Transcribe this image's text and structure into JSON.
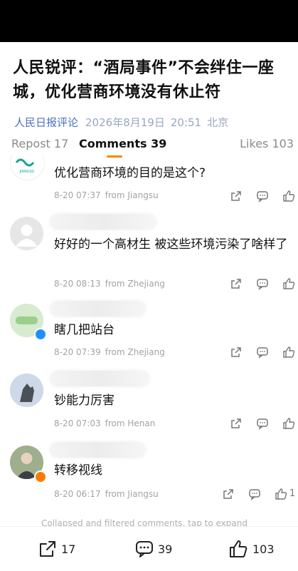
{
  "article": {
    "title": "人民锐评：“酒局事件”不会绊住一座城，优化营商环境没有休止符",
    "source": "人民日报评论",
    "date": "2026年8月19日",
    "time": "20:51",
    "location": "北京"
  },
  "tabs": {
    "repost": "Repost 17",
    "comments": "Comments 39",
    "likes": "Likes 103"
  },
  "comments": [
    {
      "text": "优化营商环境的目的是这个?",
      "time": "8-20 07:37",
      "from": "from Jiangsu",
      "avatar_icon": "logo-avatar-icon"
    },
    {
      "text": "好好的一个高材生 被这些环境污染了啥样了",
      "time": "8-20 08:13",
      "from": "from Zhejiang",
      "avatar_icon": "default-avatar-icon"
    },
    {
      "text": "瞎几把站台",
      "time": "8-20 07:39",
      "from": "from Zhejiang",
      "avatar_icon": "green-avatar-icon"
    },
    {
      "text": "钞能力厉害",
      "time": "8-20 07:03",
      "from": "from Henan",
      "avatar_icon": "wolf-avatar-icon"
    },
    {
      "text": "转移视线",
      "time": "8-20 06:17",
      "from": "from Jiangsu",
      "avatar_icon": "person-avatar-icon",
      "like_count": "1"
    }
  ],
  "collapsed_note": "Collapsed and filtered comments, tap to expand",
  "bottom_bar": {
    "repost_count": "17",
    "comment_count": "39",
    "like_count": "103"
  },
  "colors": {
    "accent": "#ff8200",
    "source_link": "#4b70b8",
    "verified_blue": "#1e90ff",
    "verified_orange": "#ff7a00"
  }
}
